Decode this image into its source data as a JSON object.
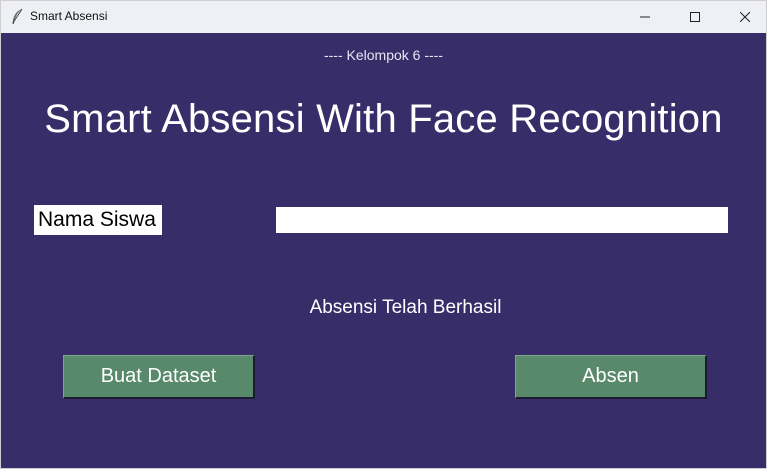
{
  "window": {
    "title": "Smart Absensi",
    "icon": "feather-icon"
  },
  "header": {
    "subtitle": "---- Kelompok 6 ----",
    "title": "Smart Absensi With Face Recognition"
  },
  "form": {
    "name_label": "Nama Siswa",
    "name_value": ""
  },
  "status": {
    "message": "Absensi Telah Berhasil"
  },
  "buttons": {
    "create_dataset": "Buat Dataset",
    "attend": "Absen"
  },
  "colors": {
    "background": "#372d69",
    "button": "#57896a",
    "titlebar": "#eef0f5"
  }
}
